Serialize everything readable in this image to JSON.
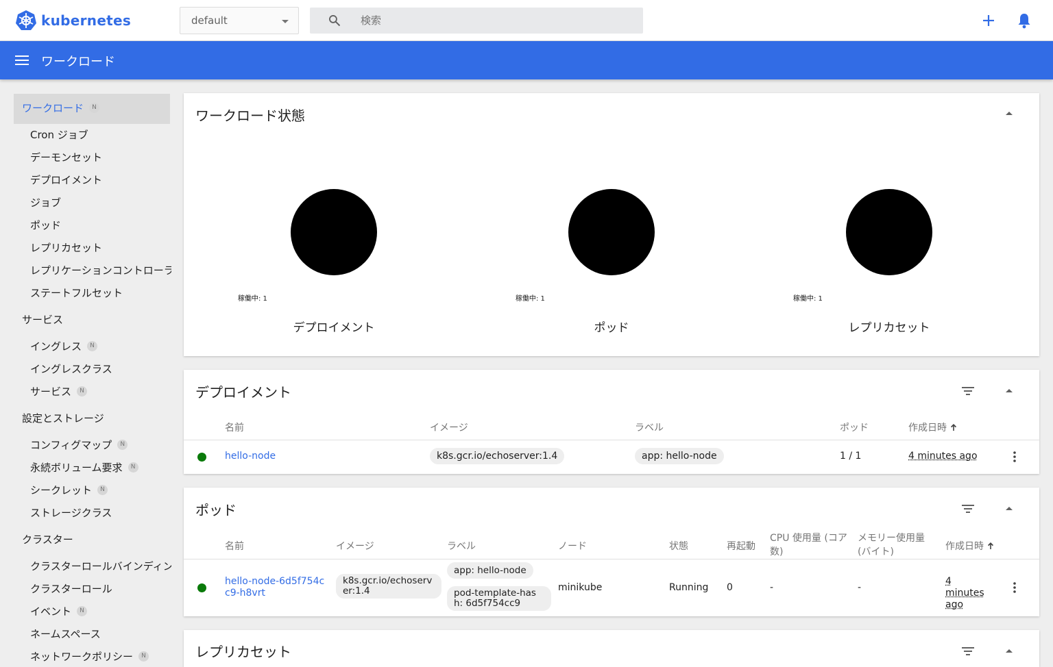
{
  "app": {
    "logo_text": "kubernetes"
  },
  "namespace": {
    "selected": "default"
  },
  "search": {
    "placeholder": "検索"
  },
  "header": {
    "title": "ワークロード"
  },
  "sidebar": {
    "workloads": {
      "label": "ワークロード",
      "badge": "N"
    },
    "workload_items": [
      {
        "label": "Cron ジョブ"
      },
      {
        "label": "デーモンセット"
      },
      {
        "label": "デプロイメント"
      },
      {
        "label": "ジョブ"
      },
      {
        "label": "ポッド"
      },
      {
        "label": "レプリカセット"
      },
      {
        "label": "レプリケーションコントローラー"
      },
      {
        "label": "ステートフルセット"
      }
    ],
    "service_group": "サービス",
    "service_items": [
      {
        "label": "イングレス",
        "badge": "N"
      },
      {
        "label": "イングレスクラス"
      },
      {
        "label": "サービス",
        "badge": "N"
      }
    ],
    "storage_group": "設定とストレージ",
    "storage_items": [
      {
        "label": "コンフィグマップ",
        "badge": "N"
      },
      {
        "label": "永続ボリューム要求",
        "badge": "N"
      },
      {
        "label": "シークレット",
        "badge": "N"
      },
      {
        "label": "ストレージクラス"
      }
    ],
    "cluster_group": "クラスター",
    "cluster_items": [
      {
        "label": "クラスターロールバインディング"
      },
      {
        "label": "クラスターロール"
      },
      {
        "label": "イベント",
        "badge": "N"
      },
      {
        "label": "ネームスペース"
      },
      {
        "label": "ネットワークポリシー",
        "badge": "N"
      }
    ]
  },
  "status_card": {
    "title": "ワークロード状態",
    "charts": [
      {
        "legend": "稼働中: 1",
        "label": "デプロイメント",
        "running": 1
      },
      {
        "legend": "稼働中: 1",
        "label": "ポッド",
        "running": 1
      },
      {
        "legend": "稼働中: 1",
        "label": "レプリカセット",
        "running": 1
      }
    ]
  },
  "deployments": {
    "title": "デプロイメント",
    "headers": {
      "name": "名前",
      "image": "イメージ",
      "labels": "ラベル",
      "pods": "ポッド",
      "created": "作成日時"
    },
    "rows": [
      {
        "name": "hello-node",
        "image": "k8s.gcr.io/echoserver:1.4",
        "label": "app: hello-node",
        "pods": "1 / 1",
        "created": "4 minutes ago"
      }
    ]
  },
  "pods": {
    "title": "ポッド",
    "headers": {
      "name": "名前",
      "image": "イメージ",
      "labels": "ラベル",
      "node": "ノード",
      "status": "状態",
      "restarts": "再起動",
      "cpu": "CPU 使用量 (コア数)",
      "memory": "メモリー使用量 (バイト)",
      "created": "作成日時"
    },
    "rows": [
      {
        "name": "hello-node-6d5f754cc9-h8vrt",
        "image": "k8s.gcr.io/echoserver:1.4",
        "label1": "app: hello-node",
        "label2": "pod-template-hash: 6d5f754cc9",
        "node": "minikube",
        "status": "Running",
        "restarts": "0",
        "cpu": "-",
        "memory": "-",
        "created": "4 minutes ago"
      }
    ]
  },
  "replicasets": {
    "title": "レプリカセット"
  },
  "colors": {
    "brand": "#326ce5",
    "running": "#0a7a0a"
  }
}
